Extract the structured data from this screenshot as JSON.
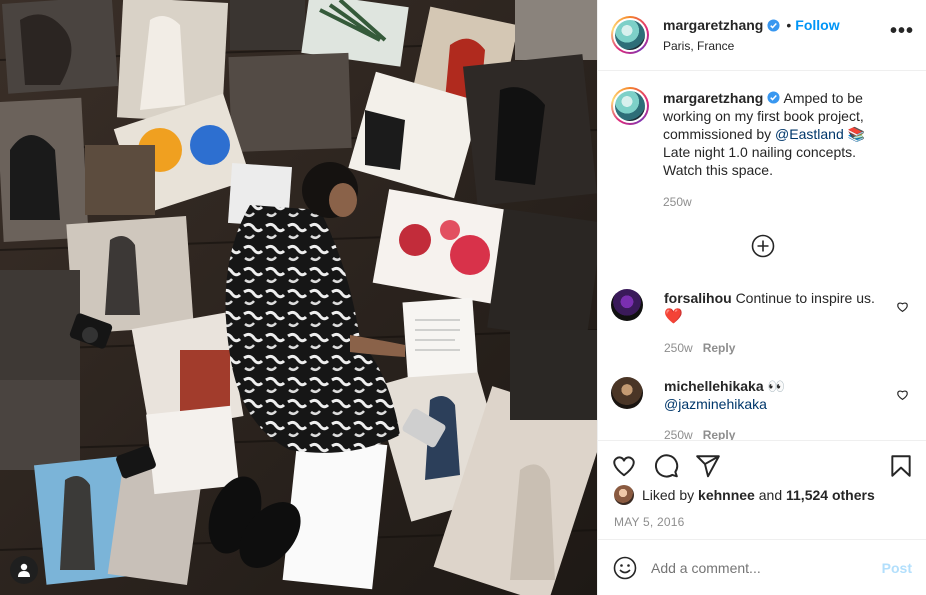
{
  "post": {
    "username": "margaretzhang",
    "follow_label": "Follow",
    "location": "Paris, France",
    "more_label": "•••",
    "caption_parts": {
      "before": "Amped to be working on my first book project, commissioned by ",
      "mention": "@Eastland",
      "emoji": "📚",
      "after": " Late night 1.0 nailing concepts. Watch this space."
    },
    "caption_time": "250w"
  },
  "comments": [
    {
      "user": "forsalihou",
      "text": "Continue to inspire us.",
      "emoji": "❤️",
      "time": "250w",
      "reply": "Reply"
    },
    {
      "user": "michellehikaka",
      "emoji": "👀",
      "mention": "@jazminehikaka",
      "time": "250w",
      "reply": "Reply"
    }
  ],
  "likes": {
    "prefix": "Liked by ",
    "user": "kehnnee",
    "middle": " and ",
    "count": "11,524 others"
  },
  "date": "MAY 5, 2016",
  "add_comment": {
    "placeholder": "Add a comment...",
    "post_label": "Post"
  },
  "icons": [
    "heart-icon",
    "comment-icon",
    "share-icon",
    "save-icon",
    "emoji-icon",
    "more-icon",
    "verified-icon",
    "load-more-icon",
    "user-tag-icon"
  ],
  "colors": {
    "link": "#0095f6",
    "mention": "#00376b",
    "muted": "#8e8e8e",
    "like_heart": "#ed4956"
  }
}
